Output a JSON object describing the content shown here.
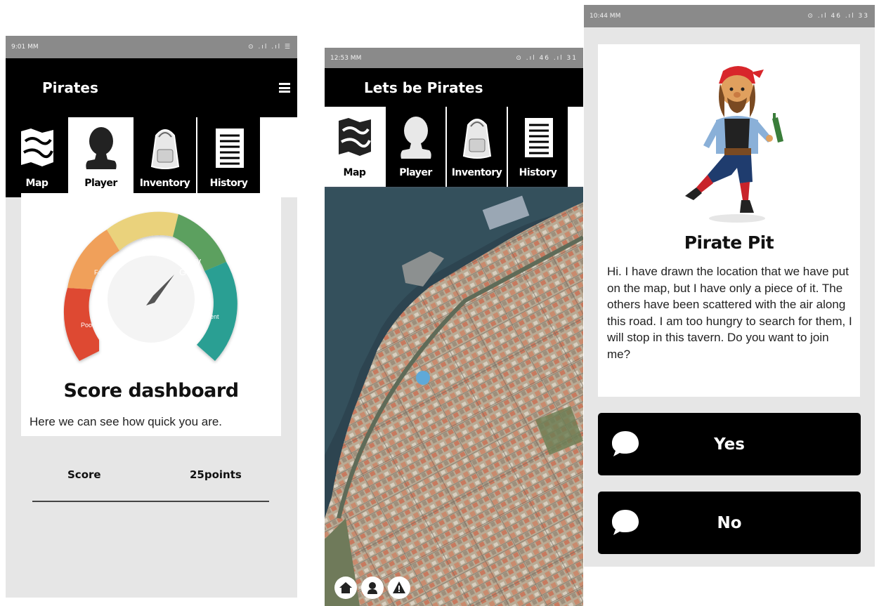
{
  "phone1": {
    "status": {
      "time": "9:01 MM",
      "icons": "⊙ .ıl .ıl ☰"
    },
    "app_bar": {
      "title": "Pirates"
    },
    "tabs": [
      {
        "label": "Map",
        "icon": "map-icon"
      },
      {
        "label": "Player",
        "icon": "player-icon"
      },
      {
        "label": "Inventory",
        "icon": "backpack-icon"
      },
      {
        "label": "History",
        "icon": "list-icon"
      }
    ],
    "active_tab": "Player",
    "gauge": {
      "segments": [
        {
          "label": "Poor",
          "color": "#de4a33"
        },
        {
          "label": "Fair",
          "color": "#f0a05a"
        },
        {
          "label": "Good",
          "color": "#ead27c"
        },
        {
          "label_line1": "Very",
          "label_line2": "Good",
          "color": "#5ba05f"
        },
        {
          "label": "Excellent",
          "color": "#2a9f93"
        }
      ]
    },
    "card": {
      "title": "Score dashboard",
      "subtitle": "Here we can see how quick you are."
    },
    "score": {
      "label": "Score",
      "value": "25points"
    }
  },
  "phone2": {
    "status": {
      "time": "12:53 MM",
      "icons": "⊙ .ıl 46 .ıl 31"
    },
    "app_bar": {
      "title": "Lets be Pirates"
    },
    "tabs": [
      {
        "label": "Map",
        "icon": "map-icon"
      },
      {
        "label": "Player",
        "icon": "player-icon"
      },
      {
        "label": "Inventory",
        "icon": "backpack-icon"
      },
      {
        "label": "History",
        "icon": "list-icon"
      }
    ],
    "active_tab": "Map",
    "map_controls": [
      "home-icon",
      "player-icon",
      "warning-icon"
    ]
  },
  "phone3": {
    "status": {
      "time": "10:44 MM",
      "icons": "⊙ .ıl 46 .ıl 33"
    },
    "dialog": {
      "title": "Pirate Pit",
      "text": "Hi. I have drawn the location that we have put on the map, but I have only a piece of it. The others have been scattered with the air along this road. I am too hungry to search for them, I will stop in this tavern. Do you want to join me?"
    },
    "buttons": {
      "yes": "Yes",
      "no": "No"
    }
  },
  "colors": {
    "bar": "#000000",
    "status": "#8a8a8a",
    "background": "#e6e6e6"
  }
}
